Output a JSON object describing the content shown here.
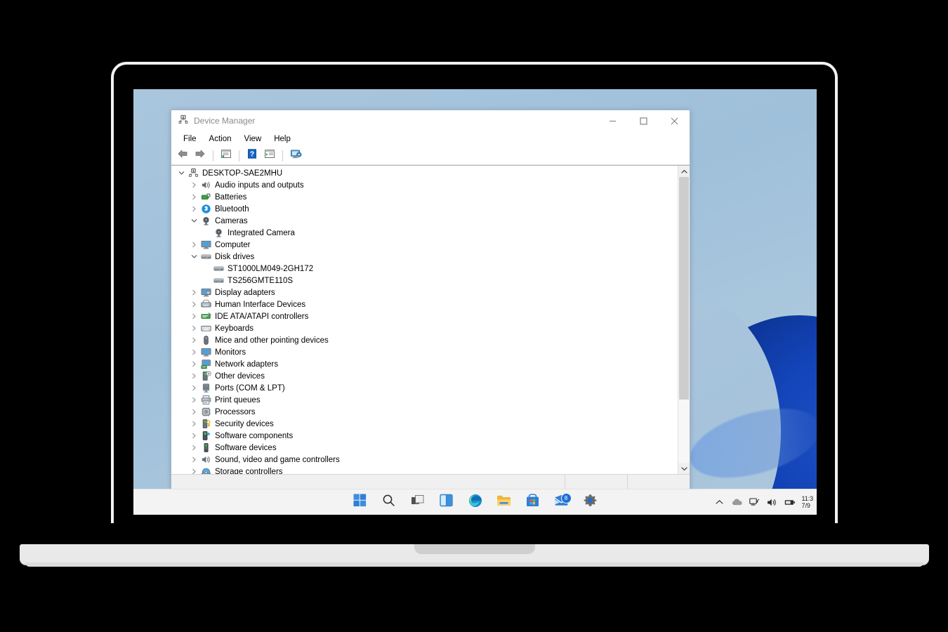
{
  "window": {
    "title": "Device Manager",
    "app_icon": "device-manager-icon",
    "minimize_label": "Minimize",
    "maximize_label": "Maximize",
    "close_label": "Close"
  },
  "menubar": {
    "items": [
      {
        "label": "File",
        "name": "menu-file"
      },
      {
        "label": "Action",
        "name": "menu-action"
      },
      {
        "label": "View",
        "name": "menu-view"
      },
      {
        "label": "Help",
        "name": "menu-help"
      }
    ]
  },
  "toolbar": {
    "buttons": [
      {
        "name": "back-button",
        "icon": "arrow-left-icon"
      },
      {
        "name": "forward-button",
        "icon": "arrow-right-icon"
      },
      {
        "name": "properties-button",
        "icon": "properties-icon"
      },
      {
        "name": "help-button",
        "icon": "help-icon"
      },
      {
        "name": "show-hide-console-tree-button",
        "icon": "console-tree-icon"
      },
      {
        "name": "scan-for-hardware-changes-button",
        "icon": "scan-hardware-icon"
      }
    ]
  },
  "tree": {
    "root_label": "DESKTOP-SAE2MHU",
    "nodes": [
      {
        "label": "DESKTOP-SAE2MHU",
        "level": 0,
        "state": "expanded",
        "icon": "computer-root-icon"
      },
      {
        "label": "Audio inputs and outputs",
        "level": 1,
        "state": "collapsed",
        "icon": "speaker-icon"
      },
      {
        "label": "Batteries",
        "level": 1,
        "state": "collapsed",
        "icon": "battery-icon"
      },
      {
        "label": "Bluetooth",
        "level": 1,
        "state": "collapsed",
        "icon": "bluetooth-icon"
      },
      {
        "label": "Cameras",
        "level": 1,
        "state": "expanded",
        "icon": "camera-icon"
      },
      {
        "label": "Integrated Camera",
        "level": 2,
        "state": "leaf",
        "icon": "camera-icon"
      },
      {
        "label": "Computer",
        "level": 1,
        "state": "collapsed",
        "icon": "monitor-icon"
      },
      {
        "label": "Disk drives",
        "level": 1,
        "state": "expanded",
        "icon": "disk-drive-icon"
      },
      {
        "label": "ST1000LM049-2GH172",
        "level": 2,
        "state": "leaf",
        "icon": "disk-drive-icon"
      },
      {
        "label": "TS256GMTE110S",
        "level": 2,
        "state": "leaf",
        "icon": "disk-drive-icon"
      },
      {
        "label": "Display adapters",
        "level": 1,
        "state": "collapsed",
        "icon": "display-adapter-icon"
      },
      {
        "label": "Human Interface Devices",
        "level": 1,
        "state": "collapsed",
        "icon": "hid-icon"
      },
      {
        "label": "IDE ATA/ATAPI controllers",
        "level": 1,
        "state": "collapsed",
        "icon": "ide-controller-icon"
      },
      {
        "label": "Keyboards",
        "level": 1,
        "state": "collapsed",
        "icon": "keyboard-icon"
      },
      {
        "label": "Mice and other pointing devices",
        "level": 1,
        "state": "collapsed",
        "icon": "mouse-icon"
      },
      {
        "label": "Monitors",
        "level": 1,
        "state": "collapsed",
        "icon": "monitor-icon"
      },
      {
        "label": "Network adapters",
        "level": 1,
        "state": "collapsed",
        "icon": "network-adapter-icon"
      },
      {
        "label": "Other devices",
        "level": 1,
        "state": "collapsed",
        "icon": "other-device-icon"
      },
      {
        "label": "Ports (COM & LPT)",
        "level": 1,
        "state": "collapsed",
        "icon": "port-icon"
      },
      {
        "label": "Print queues",
        "level": 1,
        "state": "collapsed",
        "icon": "printer-icon"
      },
      {
        "label": "Processors",
        "level": 1,
        "state": "collapsed",
        "icon": "processor-icon"
      },
      {
        "label": "Security devices",
        "level": 1,
        "state": "collapsed",
        "icon": "security-device-icon"
      },
      {
        "label": "Software components",
        "level": 1,
        "state": "collapsed",
        "icon": "software-component-icon"
      },
      {
        "label": "Software devices",
        "level": 1,
        "state": "collapsed",
        "icon": "software-device-icon"
      },
      {
        "label": "Sound, video and game controllers",
        "level": 1,
        "state": "collapsed",
        "icon": "speaker-icon"
      },
      {
        "label": "Storage controllers",
        "level": 1,
        "state": "collapsed",
        "icon": "storage-controller-icon"
      }
    ]
  },
  "scrollbar": {
    "up_arrow": "chevron-up-icon",
    "down_arrow": "chevron-down-icon",
    "thumb_position_percent": 0,
    "thumb_size_percent": 78
  },
  "statusbar": {
    "text": ""
  },
  "taskbar": {
    "items": [
      {
        "name": "start-button",
        "icon": "windows-logo-icon"
      },
      {
        "name": "search-button",
        "icon": "search-icon"
      },
      {
        "name": "task-view-button",
        "icon": "task-view-icon"
      },
      {
        "name": "widgets-button",
        "icon": "widgets-icon"
      },
      {
        "name": "edge-button",
        "icon": "edge-icon"
      },
      {
        "name": "file-explorer-button",
        "icon": "folder-icon"
      },
      {
        "name": "microsoft-store-button",
        "icon": "store-icon"
      },
      {
        "name": "mail-button",
        "icon": "mail-icon",
        "badge": "8"
      },
      {
        "name": "settings-button",
        "icon": "gear-icon"
      }
    ],
    "tray": [
      {
        "name": "show-hidden-icons-button",
        "icon": "chevron-up-icon"
      },
      {
        "name": "onedrive-tray-icon",
        "icon": "cloud-icon"
      },
      {
        "name": "network-tray-icon",
        "icon": "network-icon"
      },
      {
        "name": "volume-tray-icon",
        "icon": "volume-icon"
      },
      {
        "name": "battery-tray-icon",
        "icon": "battery-icon"
      }
    ],
    "clock": {
      "time": "11:3",
      "date": "7/9"
    }
  },
  "colors": {
    "accent": "#0078d4",
    "desktop_top": "#a9c6dd",
    "bloom_blue": "#1344b8",
    "taskbar_bg": "#f3f3f3",
    "window_bg": "#f0f0f0"
  }
}
